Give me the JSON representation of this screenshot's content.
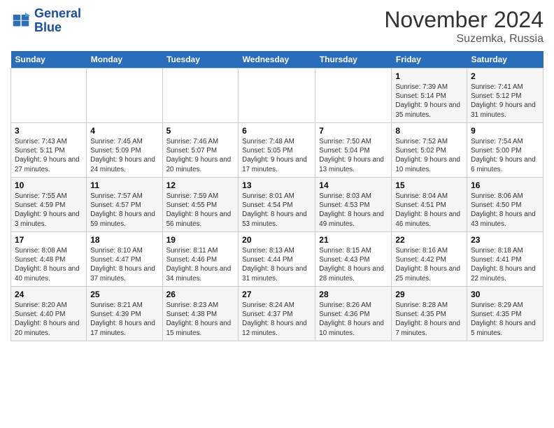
{
  "header": {
    "logo_line1": "General",
    "logo_line2": "Blue",
    "title": "November 2024",
    "location": "Suzemka, Russia"
  },
  "days_of_week": [
    "Sunday",
    "Monday",
    "Tuesday",
    "Wednesday",
    "Thursday",
    "Friday",
    "Saturday"
  ],
  "weeks": [
    [
      {
        "day": "",
        "info": ""
      },
      {
        "day": "",
        "info": ""
      },
      {
        "day": "",
        "info": ""
      },
      {
        "day": "",
        "info": ""
      },
      {
        "day": "",
        "info": ""
      },
      {
        "day": "1",
        "info": "Sunrise: 7:39 AM\nSunset: 5:14 PM\nDaylight: 9 hours\nand 35 minutes."
      },
      {
        "day": "2",
        "info": "Sunrise: 7:41 AM\nSunset: 5:12 PM\nDaylight: 9 hours\nand 31 minutes."
      }
    ],
    [
      {
        "day": "3",
        "info": "Sunrise: 7:43 AM\nSunset: 5:11 PM\nDaylight: 9 hours\nand 27 minutes."
      },
      {
        "day": "4",
        "info": "Sunrise: 7:45 AM\nSunset: 5:09 PM\nDaylight: 9 hours\nand 24 minutes."
      },
      {
        "day": "5",
        "info": "Sunrise: 7:46 AM\nSunset: 5:07 PM\nDaylight: 9 hours\nand 20 minutes."
      },
      {
        "day": "6",
        "info": "Sunrise: 7:48 AM\nSunset: 5:05 PM\nDaylight: 9 hours\nand 17 minutes."
      },
      {
        "day": "7",
        "info": "Sunrise: 7:50 AM\nSunset: 5:04 PM\nDaylight: 9 hours\nand 13 minutes."
      },
      {
        "day": "8",
        "info": "Sunrise: 7:52 AM\nSunset: 5:02 PM\nDaylight: 9 hours\nand 10 minutes."
      },
      {
        "day": "9",
        "info": "Sunrise: 7:54 AM\nSunset: 5:00 PM\nDaylight: 9 hours\nand 6 minutes."
      }
    ],
    [
      {
        "day": "10",
        "info": "Sunrise: 7:55 AM\nSunset: 4:59 PM\nDaylight: 9 hours\nand 3 minutes."
      },
      {
        "day": "11",
        "info": "Sunrise: 7:57 AM\nSunset: 4:57 PM\nDaylight: 8 hours\nand 59 minutes."
      },
      {
        "day": "12",
        "info": "Sunrise: 7:59 AM\nSunset: 4:55 PM\nDaylight: 8 hours\nand 56 minutes."
      },
      {
        "day": "13",
        "info": "Sunrise: 8:01 AM\nSunset: 4:54 PM\nDaylight: 8 hours\nand 53 minutes."
      },
      {
        "day": "14",
        "info": "Sunrise: 8:03 AM\nSunset: 4:53 PM\nDaylight: 8 hours\nand 49 minutes."
      },
      {
        "day": "15",
        "info": "Sunrise: 8:04 AM\nSunset: 4:51 PM\nDaylight: 8 hours\nand 46 minutes."
      },
      {
        "day": "16",
        "info": "Sunrise: 8:06 AM\nSunset: 4:50 PM\nDaylight: 8 hours\nand 43 minutes."
      }
    ],
    [
      {
        "day": "17",
        "info": "Sunrise: 8:08 AM\nSunset: 4:48 PM\nDaylight: 8 hours\nand 40 minutes."
      },
      {
        "day": "18",
        "info": "Sunrise: 8:10 AM\nSunset: 4:47 PM\nDaylight: 8 hours\nand 37 minutes."
      },
      {
        "day": "19",
        "info": "Sunrise: 8:11 AM\nSunset: 4:46 PM\nDaylight: 8 hours\nand 34 minutes."
      },
      {
        "day": "20",
        "info": "Sunrise: 8:13 AM\nSunset: 4:44 PM\nDaylight: 8 hours\nand 31 minutes."
      },
      {
        "day": "21",
        "info": "Sunrise: 8:15 AM\nSunset: 4:43 PM\nDaylight: 8 hours\nand 28 minutes."
      },
      {
        "day": "22",
        "info": "Sunrise: 8:16 AM\nSunset: 4:42 PM\nDaylight: 8 hours\nand 25 minutes."
      },
      {
        "day": "23",
        "info": "Sunrise: 8:18 AM\nSunset: 4:41 PM\nDaylight: 8 hours\nand 22 minutes."
      }
    ],
    [
      {
        "day": "24",
        "info": "Sunrise: 8:20 AM\nSunset: 4:40 PM\nDaylight: 8 hours\nand 20 minutes."
      },
      {
        "day": "25",
        "info": "Sunrise: 8:21 AM\nSunset: 4:39 PM\nDaylight: 8 hours\nand 17 minutes."
      },
      {
        "day": "26",
        "info": "Sunrise: 8:23 AM\nSunset: 4:38 PM\nDaylight: 8 hours\nand 15 minutes."
      },
      {
        "day": "27",
        "info": "Sunrise: 8:24 AM\nSunset: 4:37 PM\nDaylight: 8 hours\nand 12 minutes."
      },
      {
        "day": "28",
        "info": "Sunrise: 8:26 AM\nSunset: 4:36 PM\nDaylight: 8 hours\nand 10 minutes."
      },
      {
        "day": "29",
        "info": "Sunrise: 8:28 AM\nSunset: 4:35 PM\nDaylight: 8 hours\nand 7 minutes."
      },
      {
        "day": "30",
        "info": "Sunrise: 8:29 AM\nSunset: 4:35 PM\nDaylight: 8 hours\nand 5 minutes."
      }
    ]
  ]
}
